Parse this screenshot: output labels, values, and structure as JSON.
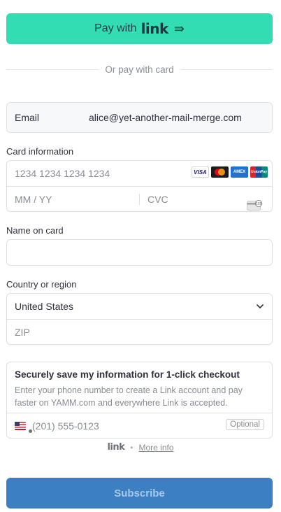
{
  "link_button": {
    "prefix": "Pay with",
    "brand": "link",
    "arrow": "⇛"
  },
  "divider": {
    "text": "Or pay with card"
  },
  "email": {
    "label": "Email",
    "value": "alice@yet-another-mail-merge.com"
  },
  "card": {
    "label": "Card information",
    "number_placeholder": "1234 1234 1234 1234",
    "expiry_placeholder": "MM / YY",
    "cvc_placeholder": "CVC",
    "brands": {
      "visa": "VISA",
      "amex": "AMEX",
      "unionpay": "UnionPay"
    },
    "cvc_icon_digits": "135"
  },
  "name": {
    "label": "Name on card",
    "value": ""
  },
  "country": {
    "label": "Country or region",
    "selected": "United States",
    "zip_placeholder": "ZIP"
  },
  "save": {
    "title": "Securely save my information for 1-click checkout",
    "description": "Enter your phone number to create a Link account and pay faster on YAMM.com and everywhere Link is accepted.",
    "phone_placeholder": "(201) 555-0123",
    "optional_label": "Optional"
  },
  "footer": {
    "brand": "link",
    "separator": "•",
    "more_info": "More info"
  },
  "subscribe": {
    "label": "Subscribe"
  },
  "colors": {
    "link_green": "#33ddb3",
    "subscribe_blue": "#3c7fc2",
    "subscribe_text": "#a9c8ea"
  }
}
